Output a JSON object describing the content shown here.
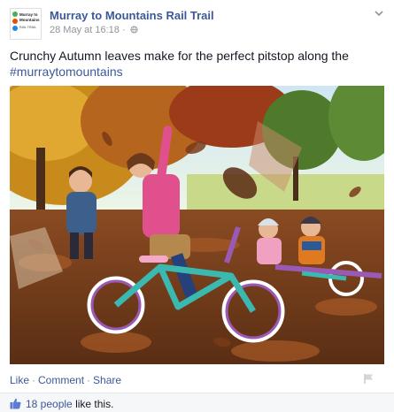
{
  "post": {
    "page_name": "Murray to Mountains Rail Trail",
    "timestamp": "28 May at 16:18",
    "meta_separator": "·",
    "text": "Crunchy Autumn leaves make for the perfect pitstop along the",
    "hashtag": "#murraytomountains",
    "avatar": {
      "line1": "Murray to",
      "line2": "Mountains",
      "line3": "RAIL TRAIL"
    },
    "photo_alt": "Children with bicycles playing in autumn leaves"
  },
  "actions": {
    "like": "Like",
    "comment": "Comment",
    "share": "Share",
    "separator": "·"
  },
  "likes": {
    "count_label": "18 people",
    "suffix": "like this."
  },
  "colors": {
    "link": "#3b5998",
    "text": "#141823",
    "meta": "#90949c"
  }
}
